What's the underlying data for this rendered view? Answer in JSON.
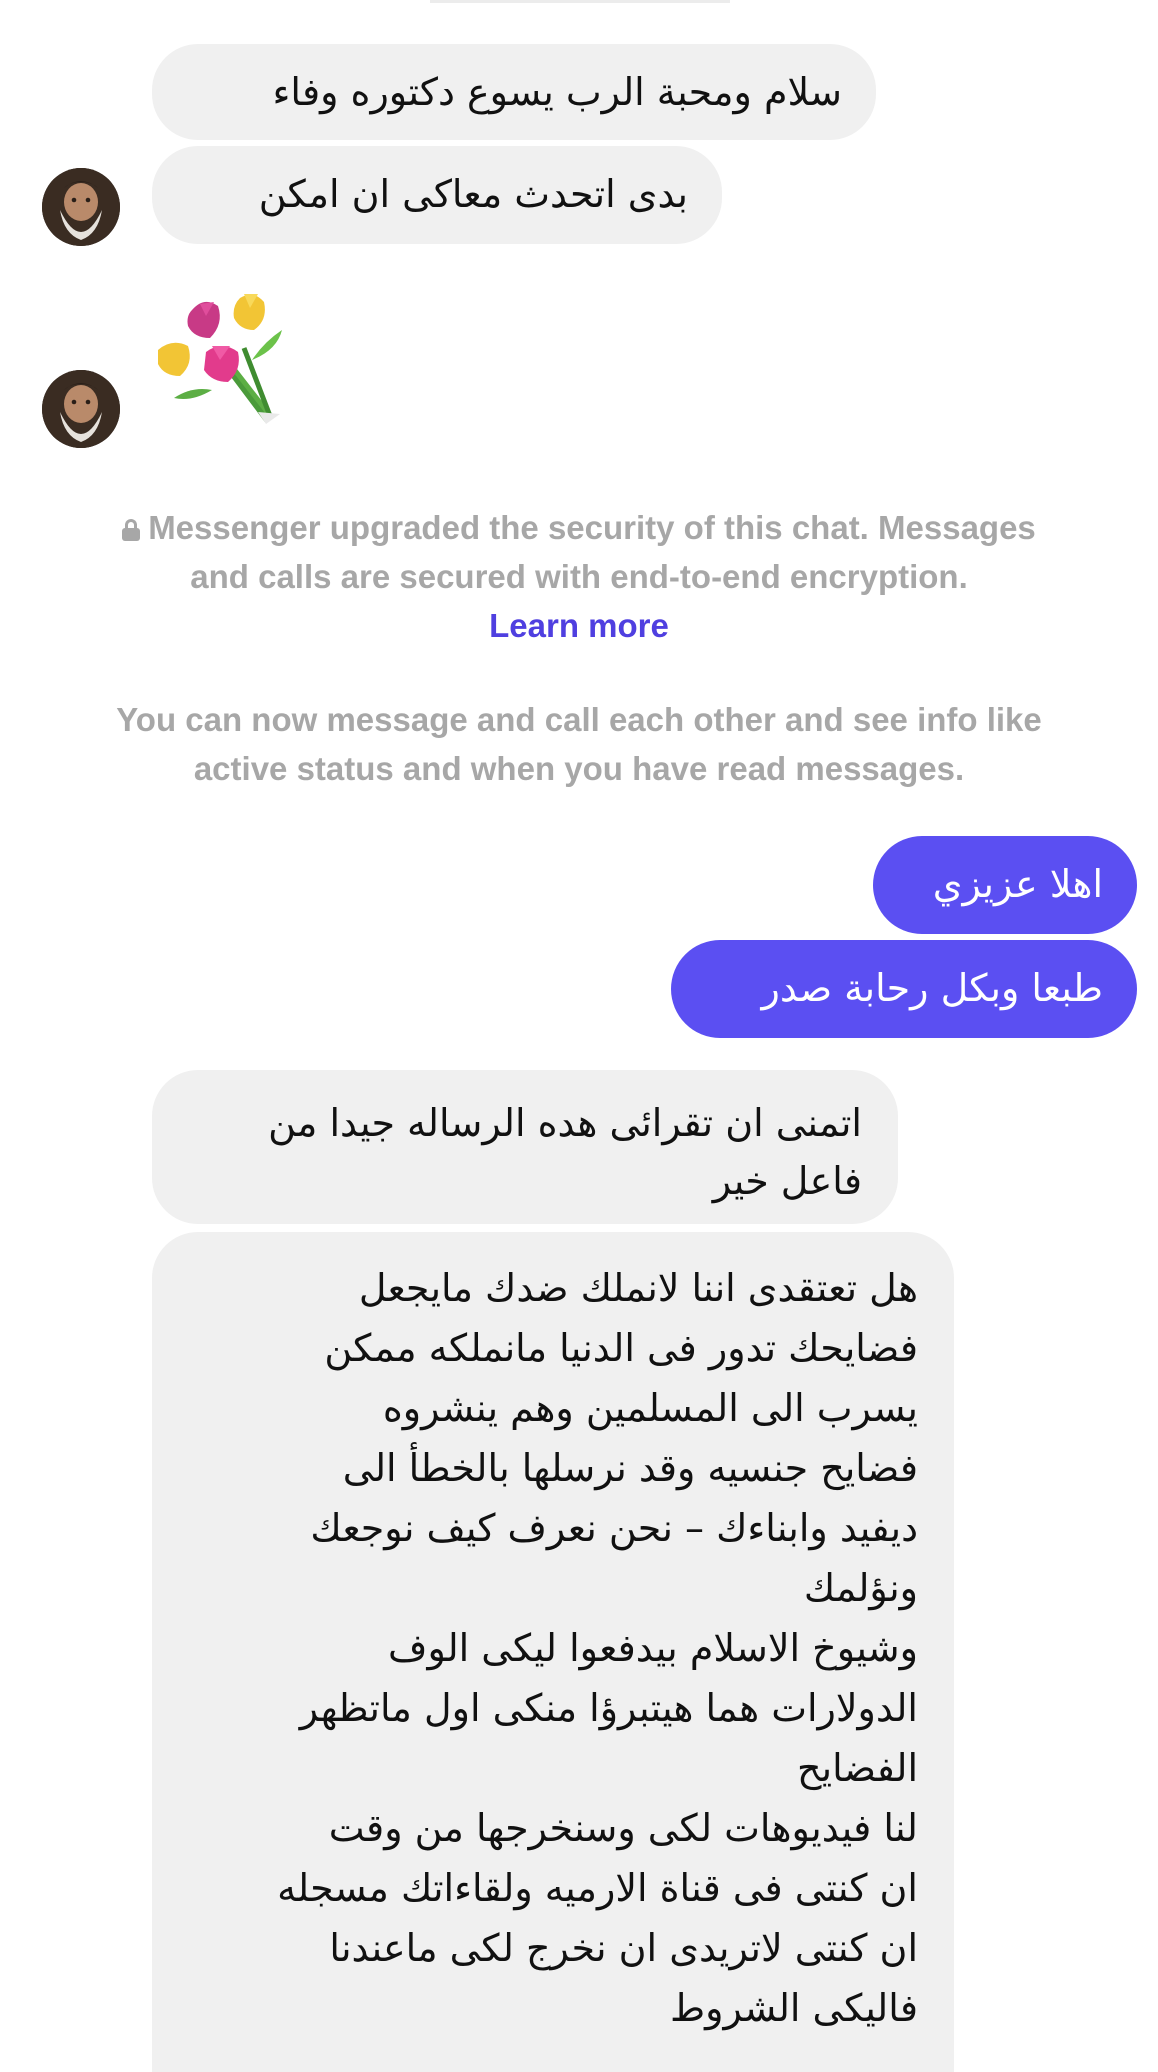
{
  "messages_incoming_top": {
    "m1": "سلام ومحبة الرب يسوع دكتوره وفاء",
    "m2": "بدى اتحدث معاكى ان امكن"
  },
  "sticker": {
    "icon": "tulip-bouquet-icon"
  },
  "security_notice": {
    "line1": "Messenger upgraded the security of this chat. Messages",
    "line2": "and calls are secured with end-to-end encryption.",
    "link": "Learn more"
  },
  "connect_notice": {
    "line1": "You can now message and call each other and see info like",
    "line2": "active status and when you have read messages."
  },
  "messages_outgoing": {
    "m1": "اهلا عزيزي",
    "m2": "طبعا وبكل رحابة صدر"
  },
  "messages_incoming_bottom": {
    "m3_lines": [
      "اتمنى ان تقرائى هده الرساله جيدا من",
      "فاعل خير"
    ],
    "m4_lines": [
      "هل تعتقدى اننا لانملك ضدك مايجعل",
      "فضايحك تدور فى الدنيا مانملكه ممكن",
      "يسرب الى المسلمين وهم ينشروه",
      "فضايح جنسيه وقد نرسلها بالخطأ الى",
      "ديفيد وابناءك – نحن نعرف كيف نوجعك",
      "ونؤلمك",
      "وشيوخ الاسلام بيدفعوا ليكى الوف",
      "الدولارات هما هيتبرؤا منكى اول ماتظهر",
      "الفضايح",
      "لنا فيديوهات لكى وسنخرجها من وقت",
      "ان كنتى فى قناة الارميه ولقاءاتك مسجله",
      "ان كنتى لاتريدى ان نخرج لكى ماعندنا",
      "فاليكى الشروط"
    ]
  },
  "colors": {
    "incoming_bubble": "#f0f0f0",
    "outgoing_bubble": "#5b4ff2",
    "notice_text": "#a7a7a7",
    "link": "#4f3fe0"
  }
}
